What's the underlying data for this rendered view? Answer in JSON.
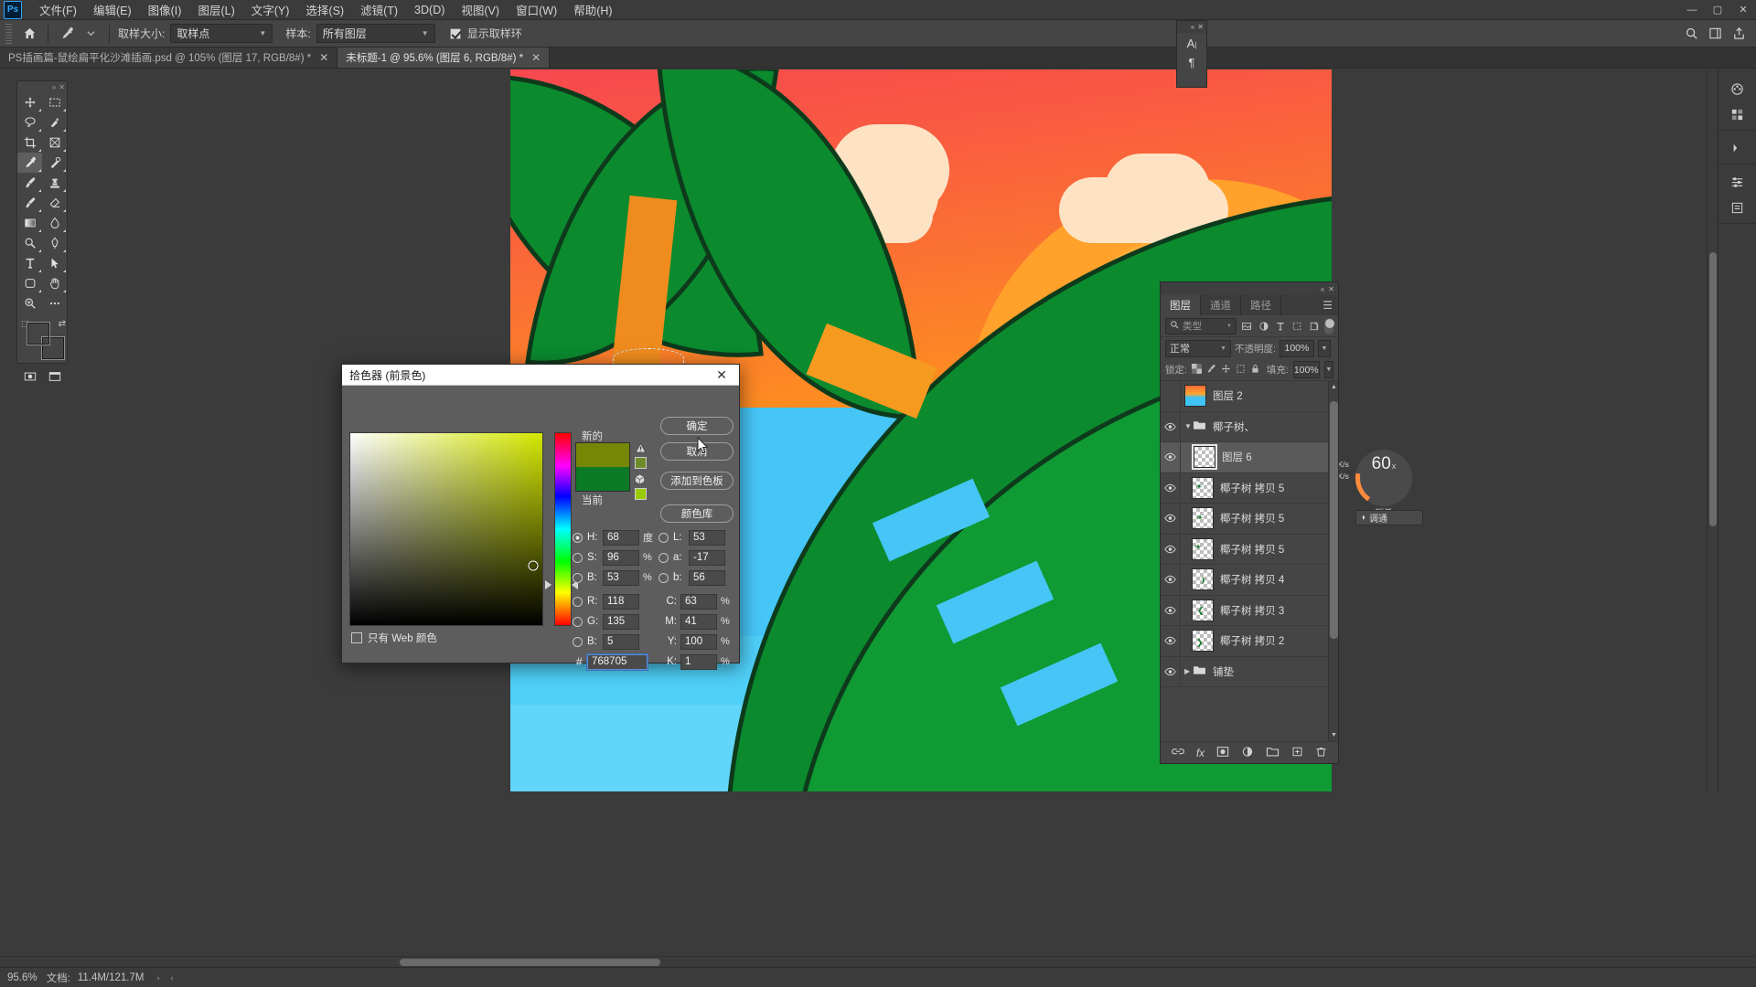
{
  "app": {
    "name": "Adobe Photoshop",
    "logo_text": "Ps"
  },
  "menubar": {
    "items": [
      {
        "label": "文件(F)"
      },
      {
        "label": "编辑(E)"
      },
      {
        "label": "图像(I)"
      },
      {
        "label": "图层(L)"
      },
      {
        "label": "文字(Y)"
      },
      {
        "label": "选择(S)"
      },
      {
        "label": "滤镜(T)"
      },
      {
        "label": "3D(D)"
      },
      {
        "label": "视图(V)"
      },
      {
        "label": "窗口(W)"
      },
      {
        "label": "帮助(H)"
      }
    ],
    "window_controls": {
      "minimize": "—",
      "maximize": "▢",
      "close": "✕"
    }
  },
  "options_bar": {
    "home_icon": "home-icon",
    "tool_icon": "eyedropper-icon",
    "sample_size_label": "取样大小:",
    "sample_size_value": "取样点",
    "sample_label": "样本:",
    "sample_value": "所有图层",
    "show_ring_label": "显示取样环",
    "show_ring_checked": true,
    "right_icons": [
      "search-icon",
      "workspace-icon",
      "share-icon"
    ]
  },
  "tabs": [
    {
      "label": "PS插画篇-鼠绘扁平化沙滩插画.psd @ 105% (图层 17, RGB/8#) *",
      "active": false,
      "close": "✕"
    },
    {
      "label": "未标题-1 @ 95.6% (图层 6, RGB/8#) *",
      "active": true,
      "close": "✕"
    }
  ],
  "toolbar": {
    "tools": [
      [
        "move-tool",
        "marquee-tool"
      ],
      [
        "lasso-tool",
        "quick-select-tool"
      ],
      [
        "crop-tool",
        "frame-tool"
      ],
      [
        "eyedropper-tool",
        "healing-brush-tool"
      ],
      [
        "brush-tool",
        "clone-stamp-tool"
      ],
      [
        "history-brush-tool",
        "eraser-tool"
      ],
      [
        "gradient-tool",
        "blur-tool"
      ],
      [
        "dodge-tool",
        "pen-tool"
      ],
      [
        "type-tool",
        "path-select-tool"
      ],
      [
        "shape-tool",
        "hand-tool"
      ],
      [
        "zoom-tool",
        "more-tools"
      ]
    ],
    "foreground_color": "#0b8a2e",
    "background_color": "#ffffff",
    "quick_mask": "quick-mask-icon",
    "screen_mode": "screen-mode-icon"
  },
  "color_picker": {
    "title": "拾色器 (前景色)",
    "close": "✕",
    "swatch_new_label": "新的",
    "swatch_current_label": "当前",
    "swatch_new_color": "#768705",
    "swatch_current_color": "#0b7a24",
    "warning_icon": "out-of-gamut-warning-icon",
    "warning_swatch_color": "#6f8c2a",
    "web_icon": "non-web-safe-icon",
    "web_swatch_color": "#99cc00",
    "buttons": {
      "ok": "确定",
      "cancel": "取消",
      "add_to_swatches": "添加到色板",
      "color_libraries": "颜色库"
    },
    "web_only_label": "只有 Web 颜色",
    "web_only_checked": false,
    "hue_value_pct": 81,
    "sv_cursor": {
      "x_pct": 94,
      "y_pct": 44
    },
    "fields": {
      "H": {
        "label": "H:",
        "value": "68",
        "unit": "度",
        "selected": true
      },
      "S": {
        "label": "S:",
        "value": "96",
        "unit": "%",
        "selected": false
      },
      "B": {
        "label": "B:",
        "value": "53",
        "unit": "%",
        "selected": false
      },
      "R": {
        "label": "R:",
        "value": "118",
        "unit": "",
        "selected": false
      },
      "G": {
        "label": "G:",
        "value": "135",
        "unit": "",
        "selected": false
      },
      "Bb": {
        "label": "B:",
        "value": "5",
        "unit": "",
        "selected": false
      },
      "L": {
        "label": "L:",
        "value": "53",
        "unit": "",
        "selected": false
      },
      "a": {
        "label": "a:",
        "value": "-17",
        "unit": "",
        "selected": false
      },
      "blab": {
        "label": "b:",
        "value": "56",
        "unit": "",
        "selected": false
      },
      "C": {
        "label": "C:",
        "value": "63",
        "unit": "%"
      },
      "M": {
        "label": "M:",
        "value": "41",
        "unit": "%"
      },
      "Y": {
        "label": "Y:",
        "value": "100",
        "unit": "%"
      },
      "K": {
        "label": "K:",
        "value": "1",
        "unit": "%"
      }
    },
    "hex_label": "#",
    "hex_value": "768705"
  },
  "mini_panel": {
    "char_icon": "character-panel-icon",
    "para_icon": "paragraph-panel-icon",
    "collapse": "«",
    "close": "✕"
  },
  "rail": {
    "buttons": [
      "color-panel-icon",
      "swatches-panel-icon",
      "libraries-icon",
      "adjustments-icon",
      "properties-icon",
      "history-icon",
      "actions-icon"
    ]
  },
  "layers_panel": {
    "collapse": "«",
    "close": "✕",
    "tabs": [
      {
        "label": "图层",
        "active": true
      },
      {
        "label": "通道",
        "active": false
      },
      {
        "label": "路径",
        "active": false
      }
    ],
    "menu_icon": "panel-menu-icon",
    "filter": {
      "search_icon": "search-icon",
      "kind_label": "类型",
      "icons": [
        "pixel-filter-icon",
        "adjustment-filter-icon",
        "type-filter-icon",
        "shape-filter-icon",
        "smart-object-filter-icon"
      ],
      "toggle": "filter-toggle"
    },
    "blend_mode": "正常",
    "opacity_label": "不透明度:",
    "opacity_value": "100%",
    "lock_label": "锁定:",
    "lock_icons": [
      "lock-transparent-icon",
      "lock-image-icon",
      "lock-position-icon",
      "lock-artboard-icon",
      "lock-all-icon"
    ],
    "fill_label": "填充:",
    "fill_value": "100%",
    "layers": [
      {
        "name": "图层 2",
        "visible": false,
        "type": "layer",
        "selected": false,
        "thumb": "artwork",
        "indent": 0
      },
      {
        "name": "椰子树、",
        "visible": true,
        "type": "group",
        "selected": false,
        "expanded": true,
        "indent": 0
      },
      {
        "name": "图层 6",
        "visible": true,
        "type": "layer",
        "selected": true,
        "thumb": "empty",
        "indent": 1
      },
      {
        "name": "椰子树 拷贝 5",
        "visible": true,
        "type": "layer",
        "selected": false,
        "thumb": "leaf",
        "indent": 1
      },
      {
        "name": "椰子树 拷贝 5",
        "visible": true,
        "type": "layer",
        "selected": false,
        "thumb": "leaf",
        "indent": 1
      },
      {
        "name": "椰子树 拷贝 5",
        "visible": true,
        "type": "layer",
        "selected": false,
        "thumb": "leaf",
        "indent": 1
      },
      {
        "name": "椰子树 拷贝 4",
        "visible": true,
        "type": "layer",
        "selected": false,
        "thumb": "leaf",
        "indent": 1
      },
      {
        "name": "椰子树 拷贝 3",
        "visible": true,
        "type": "layer",
        "selected": false,
        "thumb": "leaf",
        "indent": 1
      },
      {
        "name": "椰子树 拷贝 2",
        "visible": true,
        "type": "layer",
        "selected": false,
        "thumb": "leaf",
        "indent": 1
      },
      {
        "name": "铺垫",
        "visible": true,
        "type": "group",
        "selected": false,
        "expanded": false,
        "indent": 0
      }
    ],
    "footer_icons": [
      "link-layers-icon",
      "layer-style-icon",
      "layer-mask-icon",
      "adjustment-layer-icon",
      "new-group-icon",
      "new-layer-icon",
      "delete-layer-icon"
    ]
  },
  "speedometer": {
    "value": "60",
    "unit": "x",
    "sub_label": "瑞任",
    "read_rate": "0.1K/s",
    "write_rate": "0.1K/s",
    "adjust_label": "调通"
  },
  "status_bar": {
    "zoom": "95.6%",
    "doc_label": "文档:",
    "doc_value": "11.4M/121.7M",
    "caret_right": "›",
    "caret_left": "‹"
  }
}
